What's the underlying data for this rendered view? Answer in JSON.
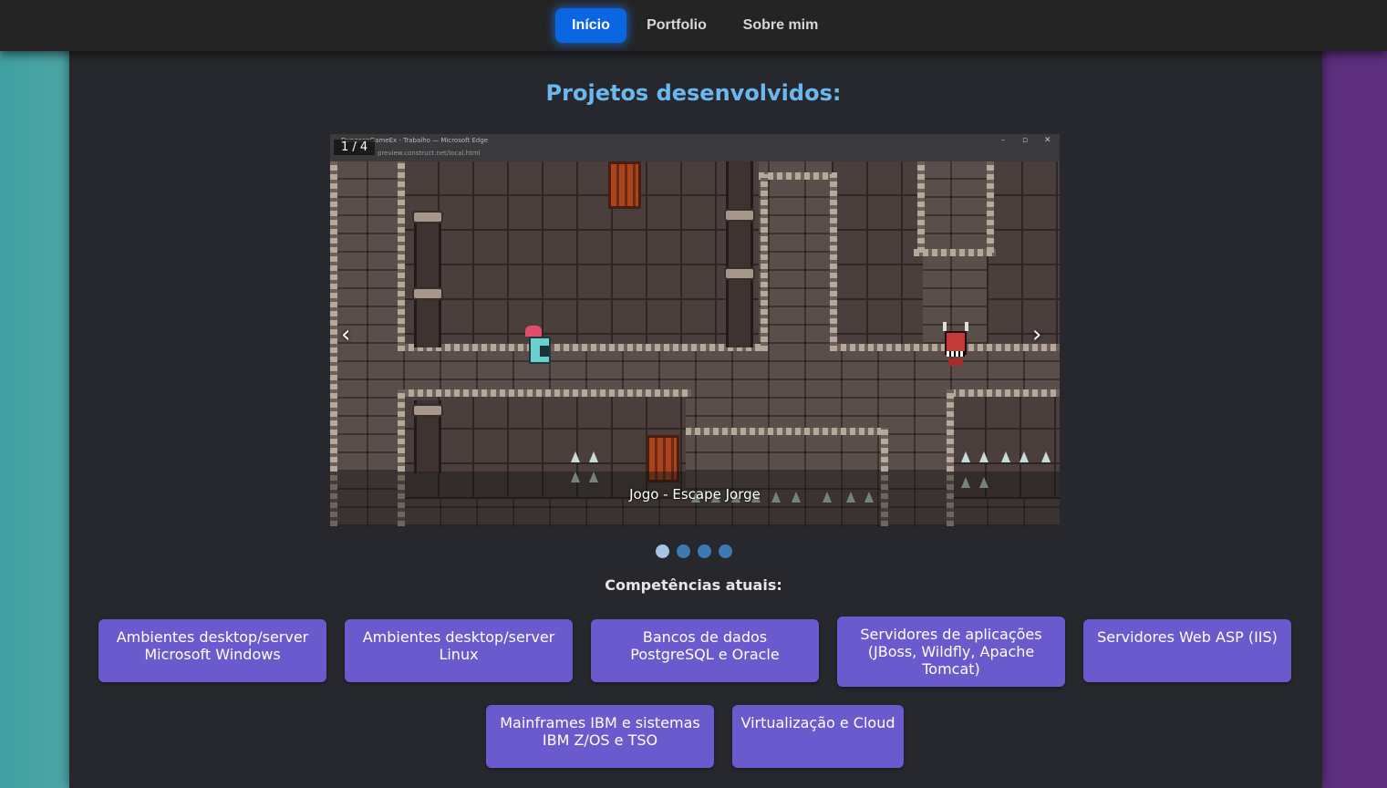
{
  "nav": {
    "items": [
      {
        "label": "Início",
        "active": true
      },
      {
        "label": "Portfolio",
        "active": false
      },
      {
        "label": "Sobre mim",
        "active": false
      }
    ]
  },
  "main": {
    "title": "Projetos desenvolvidos:"
  },
  "carousel": {
    "counter": "1 / 4",
    "caption": "Jogo - Escape Jorge",
    "prev_icon": "‹",
    "next_icon": "›",
    "slide_count": 4,
    "active_slide": 1,
    "window_title": "DungeonGameEx - Trabalho — Microsoft Edge",
    "window_url": "preview.construct.net/local.html"
  },
  "skills": {
    "title": "Competências atuais:",
    "items": [
      "Ambientes desktop/server\nMicrosoft Windows",
      "Ambientes desktop/server\nLinux",
      "Bancos de dados\nPostgreSQL e Oracle",
      "Servidores de aplicações\n(JBoss, Wildfly, Apache\nTomcat)",
      "Servidores Web ASP (IIS)",
      "Mainframes IBM e sistemas\nIBM Z/OS e TSO",
      "Virtualização e Cloud"
    ]
  },
  "colors": {
    "accent_nav": "#0a66e0",
    "title": "#6bb8ef",
    "skill_bg": "#6a5acd",
    "left_band": "#4aa5a5",
    "right_band": "#5e2f7e"
  }
}
